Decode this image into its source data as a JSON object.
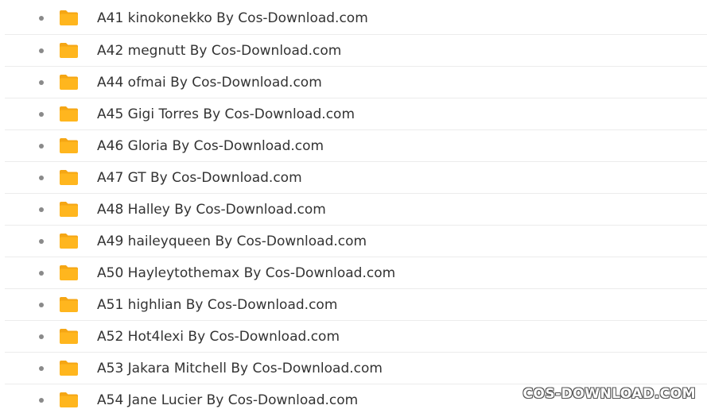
{
  "files": {
    "items": [
      {
        "label": "A41 kinokonekko By Cos-Download.com",
        "icon": "folder-icon"
      },
      {
        "label": "A42 megnutt By Cos-Download.com",
        "icon": "folder-icon"
      },
      {
        "label": "A44 ofmai By Cos-Download.com",
        "icon": "folder-icon"
      },
      {
        "label": "A45 Gigi Torres By Cos-Download.com",
        "icon": "folder-icon"
      },
      {
        "label": "A46 Gloria By Cos-Download.com",
        "icon": "folder-icon"
      },
      {
        "label": "A47 GT By Cos-Download.com",
        "icon": "folder-icon"
      },
      {
        "label": "A48 Halley By Cos-Download.com",
        "icon": "folder-icon"
      },
      {
        "label": "A49 haileyqueen By Cos-Download.com",
        "icon": "folder-icon"
      },
      {
        "label": "A50 Hayleytothemax By Cos-Download.com",
        "icon": "folder-icon"
      },
      {
        "label": "A51 highlian By Cos-Download.com",
        "icon": "folder-icon"
      },
      {
        "label": "A52 Hot4lexi By Cos-Download.com",
        "icon": "folder-icon"
      },
      {
        "label": "A53 Jakara Mitchell By Cos-Download.com",
        "icon": "folder-icon"
      },
      {
        "label": "A54 Jane Lucier By Cos-Download.com",
        "icon": "folder-icon"
      }
    ]
  },
  "watermark": "COS-DOWNLOAD.COM",
  "colors": {
    "folder": "#FFB61E",
    "folder_tab": "#F5A614",
    "text": "#333333",
    "bullet": "#8A8A8A",
    "divider": "#ECECEC"
  }
}
